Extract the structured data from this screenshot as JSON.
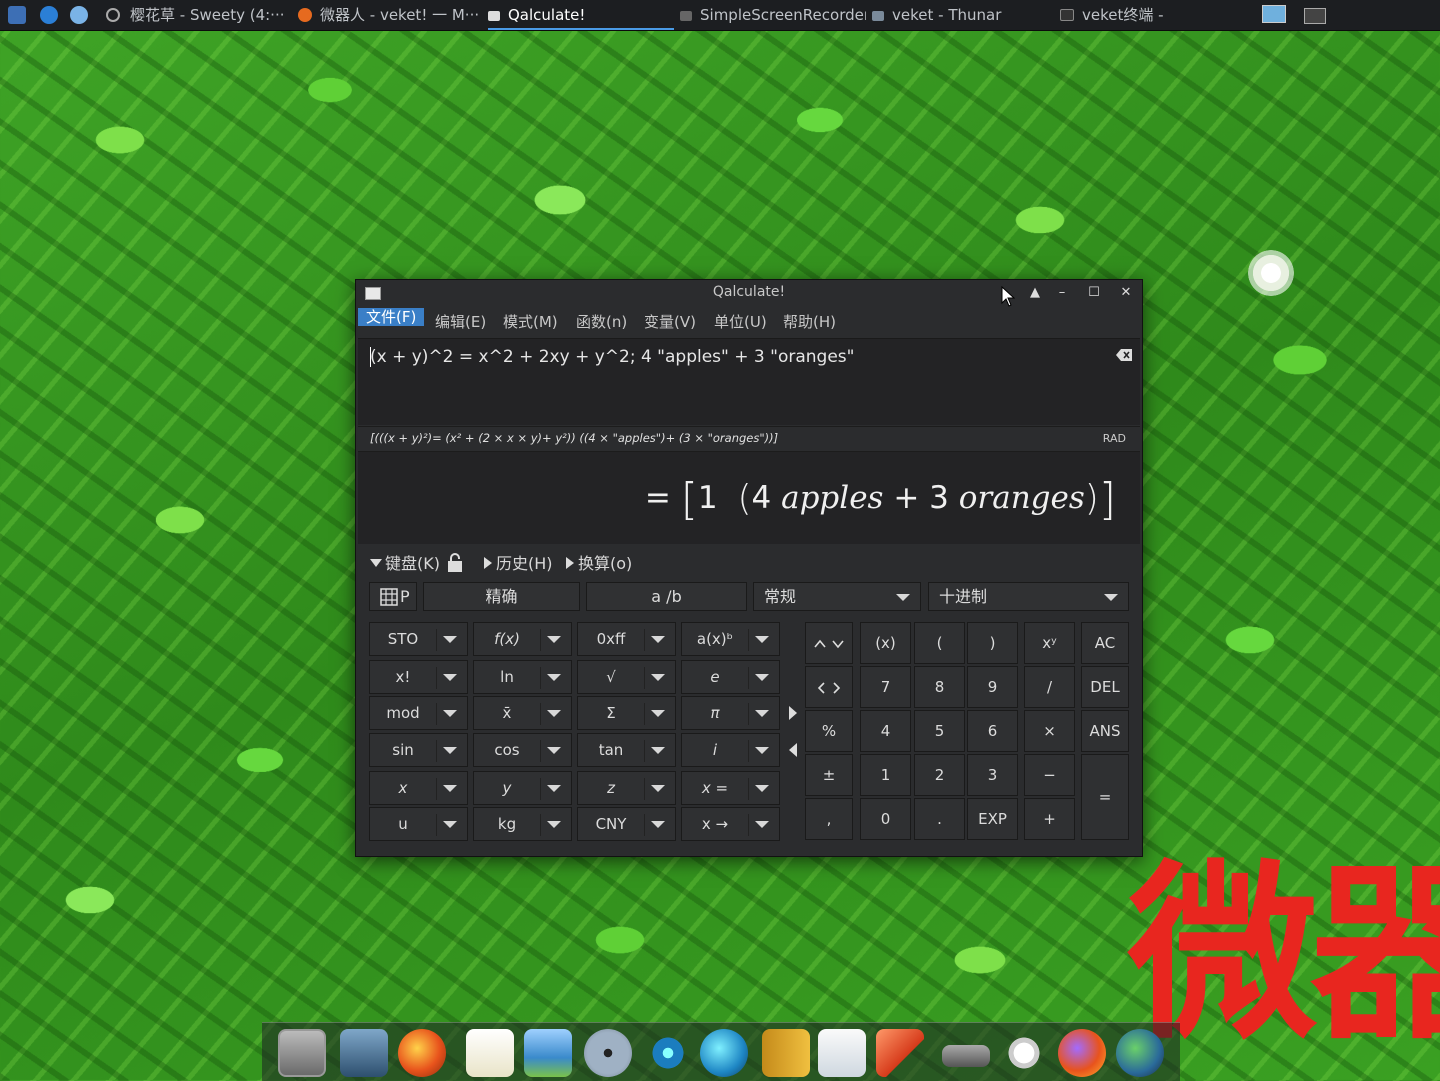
{
  "taskbar": {
    "tasks": [
      {
        "label": "樱花草 - Sweety (4:···"
      },
      {
        "label": "微器人 - veket! 一 M···"
      },
      {
        "label": "Qalculate!"
      },
      {
        "label": "SimpleScreenRecorder"
      },
      {
        "label": "veket - Thunar"
      },
      {
        "label": "veket终端 -"
      }
    ]
  },
  "window": {
    "title": "Qalculate!",
    "menu": [
      "文件(F)",
      "编辑(E)",
      "模式(M)",
      "函数(n)",
      "变量(V)",
      "单位(U)",
      "帮助(H)"
    ],
    "expression": "(x + y)^2 = x^2 + 2xy + y^2; 4 \"apples\" + 3 \"oranges\"",
    "parsed": "[(((x + y)²)= (x² + (2 × x × y)+ y²)) ((4 × \"apples\")+ (3 × \"oranges\"))]",
    "angle_mode": "RAD",
    "result": {
      "equals": "=",
      "one": "1",
      "four": "4",
      "apples": "apples",
      "plus": "+",
      "three": "3",
      "oranges": "oranges"
    },
    "sections": {
      "keyboard": "键盘(K)",
      "history": "历史(H)",
      "conversion": "换算(o)"
    },
    "options": {
      "keypad_p": "P",
      "exact": "精确",
      "fraction": "a  /b",
      "general": "常规",
      "decimal": "十进制"
    },
    "func_keys": [
      [
        "STO",
        "f(x)",
        "0xff",
        "a(x)ᵇ"
      ],
      [
        "x!",
        "ln",
        "√",
        "e"
      ],
      [
        "mod",
        "x̄",
        "Σ",
        "π"
      ],
      [
        "sin",
        "cos",
        "tan",
        "i"
      ],
      [
        "x",
        "y",
        "z",
        "x ="
      ],
      [
        "u",
        "kg",
        "CNY",
        "x →"
      ]
    ],
    "num_keys": {
      "r0": [
        "(x)",
        "(",
        ")",
        "xʸ",
        "AC"
      ],
      "r1": [
        "7",
        "8",
        "9",
        "/",
        "DEL"
      ],
      "r2": [
        "%",
        "4",
        "5",
        "6",
        "×",
        "ANS"
      ],
      "r3": [
        "±",
        "1",
        "2",
        "3",
        "−",
        "="
      ],
      "r4": [
        ",",
        "0",
        ".",
        "EXP",
        "+"
      ]
    }
  },
  "desktop": {
    "watermark": "微器"
  },
  "colors": {
    "selection": "#3a7fc7",
    "window_bg": "#2b2c2e",
    "watermark": "#e8261f"
  }
}
